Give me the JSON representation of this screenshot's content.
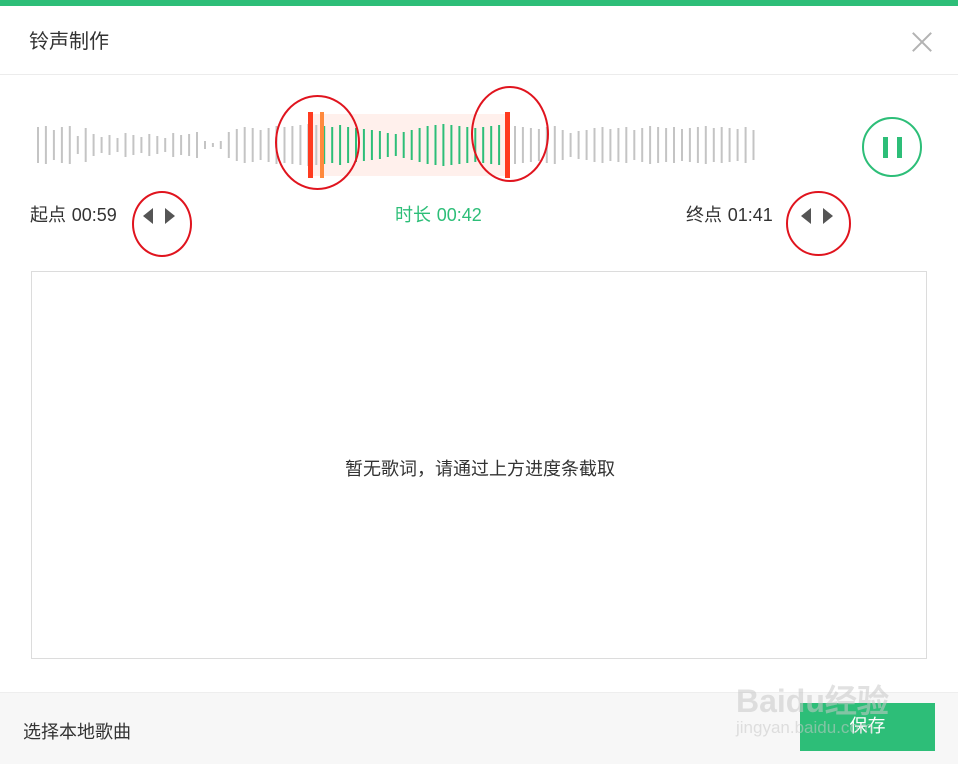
{
  "dialog": {
    "title": "铃声制作",
    "close_icon": "close-icon"
  },
  "trim": {
    "start_label": "起点",
    "start_time": "00:59",
    "end_label": "终点",
    "end_time": "01:41",
    "duration_label": "时长",
    "duration_time": "00:42",
    "play_state_icon": "pause-icon"
  },
  "lyrics": {
    "empty_text": "暂无歌词，请通过上方进度条截取"
  },
  "footer": {
    "local_song_label": "选择本地歌曲",
    "save_label": "保存"
  },
  "watermark": {
    "brand": "Baidu经验",
    "url": "jingyan.baidu.com"
  },
  "colors": {
    "accent": "#2dbe78",
    "handle": "#ff3b1f",
    "playhead": "#ff8a3d",
    "selection_bg": "#fff0ec",
    "wave_inactive": "#c4c4c4",
    "annotation": "#e0141e"
  }
}
